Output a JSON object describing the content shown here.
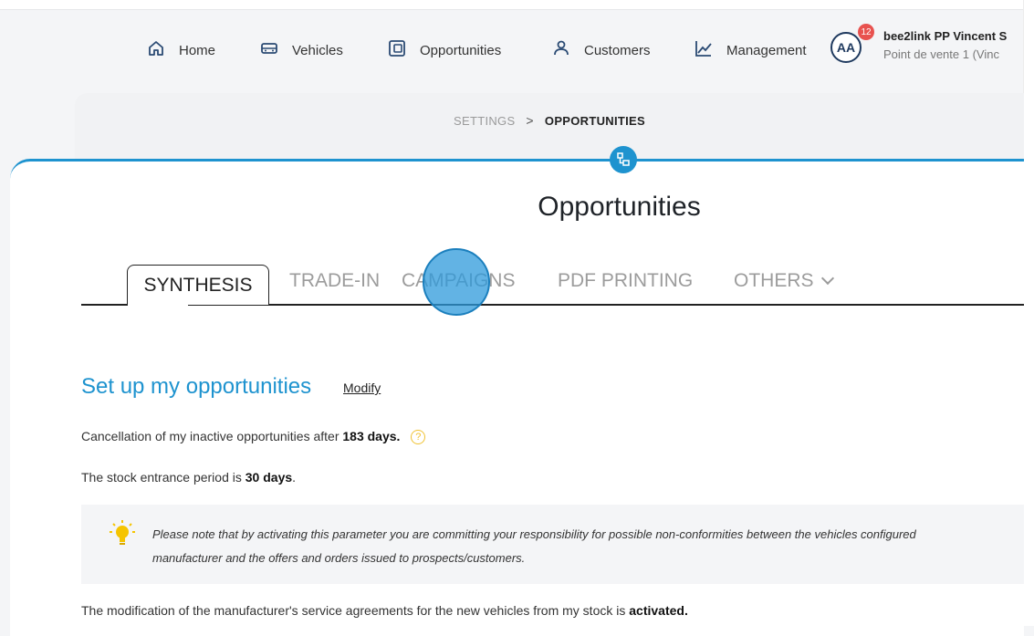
{
  "nav": {
    "items": [
      {
        "label": "Home",
        "icon": "home-icon"
      },
      {
        "label": "Vehicles",
        "icon": "car-icon"
      },
      {
        "label": "Opportunities",
        "icon": "opportunities-icon"
      },
      {
        "label": "Customers",
        "icon": "customers-icon"
      },
      {
        "label": "Management",
        "icon": "chart-icon"
      }
    ],
    "avatar_initials": "AA",
    "notification_count": "12",
    "user_name": "bee2link PP Vincent S",
    "user_store": "Point de vente 1 (Vinc"
  },
  "breadcrumb": {
    "settings": "SETTINGS",
    "separator": ">",
    "current": "OPPORTUNITIES"
  },
  "page": {
    "title": "Opportunities"
  },
  "tabs": {
    "synthesis": "SYNTHESIS",
    "trade_in": "TRADE-IN",
    "campaigns": "CAMPAIGNS",
    "pdf_printing": "PDF PRINTING",
    "others": "OTHERS"
  },
  "content": {
    "section_title": "Set up my opportunities",
    "modify_link": "Modify",
    "cancel_text": "Cancellation of my inactive opportunities after ",
    "cancel_value": "183 days.",
    "help_glyph": "?",
    "stock_text": "The stock entrance period is ",
    "stock_value": "30 days",
    "stock_end": ".",
    "note_line1": "Please note that by activating this parameter you are committing your responsibility for possible non-conformities between the vehicles configured",
    "note_line2": "manufacturer and the offers and orders issued to prospects/customers.",
    "service_text": "The modification of the manufacturer's service agreements for the new vehicles from my stock is ",
    "service_value": "activated."
  },
  "colors": {
    "accent": "#1e93cf",
    "badge": "#e8524f",
    "help": "#f0c232",
    "click_marker": "#2d9adb"
  }
}
